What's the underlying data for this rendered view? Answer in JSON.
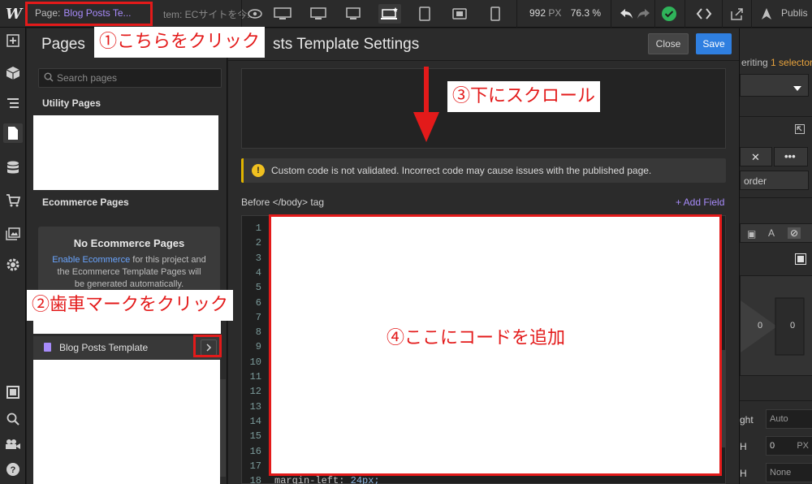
{
  "topbar": {
    "page_label": "Page:",
    "page_name": "Blog Posts Te...",
    "item_label": "tem: ECサイトを今...",
    "width_value": "992",
    "width_unit": "PX",
    "zoom": "76.3 %",
    "publish": "Publis"
  },
  "pages_panel": {
    "title": "Pages",
    "search_placeholder": "Search pages",
    "utility_section": "Utility Pages",
    "ecommerce_section": "Ecommerce Pages",
    "no_ecom_title": "No Ecommerce Pages",
    "no_ecom_link": "Enable Ecommerce",
    "no_ecom_line1_rest": " for this project and",
    "no_ecom_line2": "the Ecommerce Template Pages will",
    "no_ecom_line3": "be generated automatically.",
    "blog_template": "Blog Posts Template"
  },
  "settings": {
    "title": "sts Template Settings",
    "close": "Close",
    "save": "Save",
    "warning": "Custom code is not validated. Incorrect code may cause issues with the published page.",
    "before_body": "Before </body> tag",
    "add_field": "+ Add Field",
    "line_numbers": [
      "1",
      "2",
      "3",
      "4",
      "5",
      "6",
      "7",
      "8",
      "9",
      "10",
      "11",
      "12",
      "13",
      "14",
      "15",
      "16",
      "17",
      "18"
    ],
    "last_code_prop": "margin-left:",
    "last_code_val": " 24px;"
  },
  "right_panel": {
    "inheriting": "eriting",
    "selector_count": "1 selector",
    "order": "order",
    "margin_values": [
      "0",
      "0"
    ],
    "auto": "Auto",
    "zero_px": "0",
    "px": "PX",
    "none": "None",
    "labels": [
      "ght",
      "H",
      "H"
    ]
  },
  "annotations": {
    "step1": "①こちらをクリック",
    "step2": "②歯車マークをクリック",
    "step3": "③下にスクロール",
    "step4": "④ここにコードを追加"
  },
  "colors": {
    "accent_purple": "#a78bfa",
    "save_blue": "#2f7fe0",
    "annotation_red": "#e31a1a",
    "warning_yellow": "#f0c020",
    "success_green": "#2fb35a"
  }
}
